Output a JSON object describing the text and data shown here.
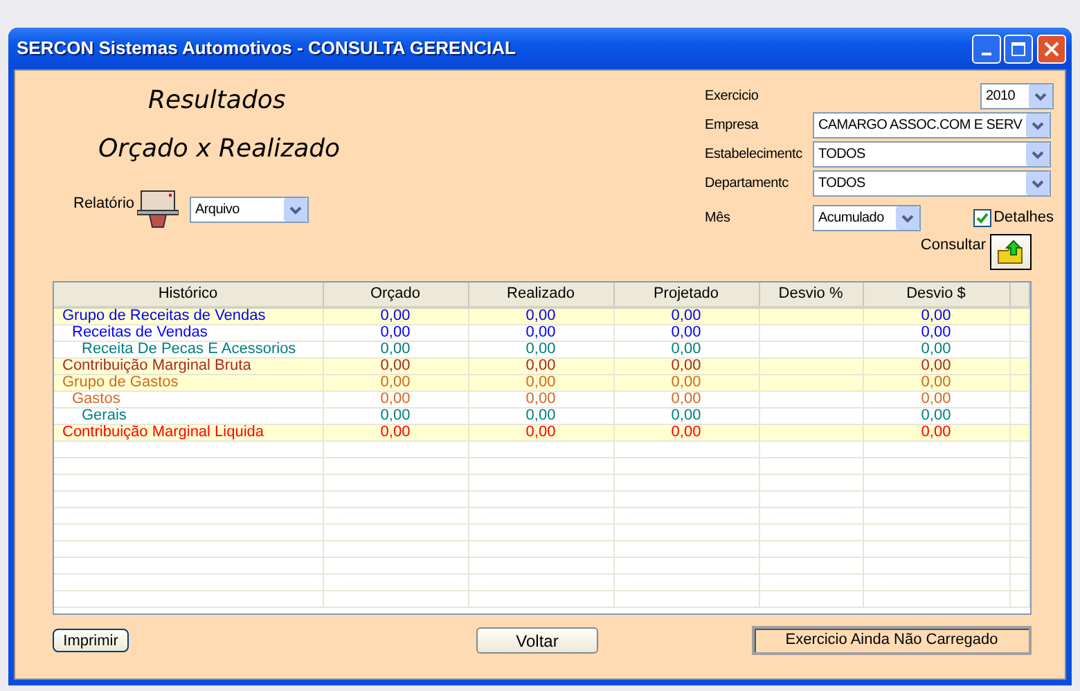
{
  "window": {
    "title": "SERCON Sistemas Automotivos - CONSULTA GERENCIAL"
  },
  "heading": {
    "line_1": "Resultados",
    "line_2": "Orçado x Realizado"
  },
  "report": {
    "label": "Relatório",
    "value": "Arquivo"
  },
  "filters": [
    {
      "label": "Exercicio",
      "value": "2010"
    },
    {
      "label": "Empresa",
      "value": "CAMARGO ASSOC.COM E SERV"
    },
    {
      "label": "Estabelecimentc",
      "value": "TODOS"
    },
    {
      "label": "Departamentc",
      "value": "TODOS"
    }
  ],
  "month": {
    "label": "Mês",
    "value": "Acumulado"
  },
  "details": {
    "label": "Detalhes",
    "checked": true
  },
  "query": {
    "label": "Consultar"
  },
  "table": {
    "columns": [
      "Histórico",
      "Orçado",
      "Realizado",
      "Projetado",
      "Desvio %",
      "Desvio $"
    ],
    "rows": [
      {
        "label": "Grupo de Receitas de Vendas",
        "color": "#0000ff",
        "highlighted": true,
        "orcado": "0,00",
        "realizado": "0,00",
        "projetado": "0,00",
        "desvio_valor": "0,00",
        "children": [
          {
            "label": "Receitas de Vendas",
            "color": "#0000ff",
            "highlighted": false,
            "orcado": "0,00",
            "realizado": "0,00",
            "projetado": "0,00",
            "desvio_valor": "0,00",
            "children": [
              {
                "label": "Receita De Pecas E Acessorios",
                "color": "#008080",
                "highlighted": false,
                "orcado": "0,00",
                "realizado": "0,00",
                "projetado": "0,00",
                "desvio_valor": "0,00"
              }
            ]
          }
        ]
      },
      {
        "label": "Contribuição Marginal Bruta",
        "color": "#a52a2a",
        "highlighted": true,
        "orcado": "0,00",
        "realizado": "0,00",
        "projetado": "0,00",
        "desvio_valor": "0,00"
      },
      {
        "label": "Grupo de Gastos",
        "color": "#d2691e",
        "highlighted": true,
        "orcado": "0,00",
        "realizado": "0,00",
        "projetado": "0,00",
        "desvio_valor": "0,00",
        "children": [
          {
            "label": "Gastos",
            "color": "#d2691e",
            "highlighted": false,
            "orcado": "0,00",
            "realizado": "0,00",
            "projetado": "0,00",
            "desvio_valor": "0,00",
            "children": [
              {
                "label": "Gerais",
                "color": "#008080",
                "highlighted": false,
                "orcado": "0,00",
                "realizado": "0,00",
                "projetado": "0,00",
                "desvio_valor": "0,00"
              }
            ]
          }
        ]
      },
      {
        "label": "Contribuição Marginal Liquida",
        "color": "#ff0000",
        "highlighted": true,
        "orcado": "0,00",
        "realizado": "0,00",
        "projetado": "0,00",
        "desvio_valor": "0,00"
      }
    ]
  },
  "buttons": {
    "print": "Imprimir",
    "back": "Voltar"
  },
  "status": "Exercicio Ainda Não Carregado"
}
